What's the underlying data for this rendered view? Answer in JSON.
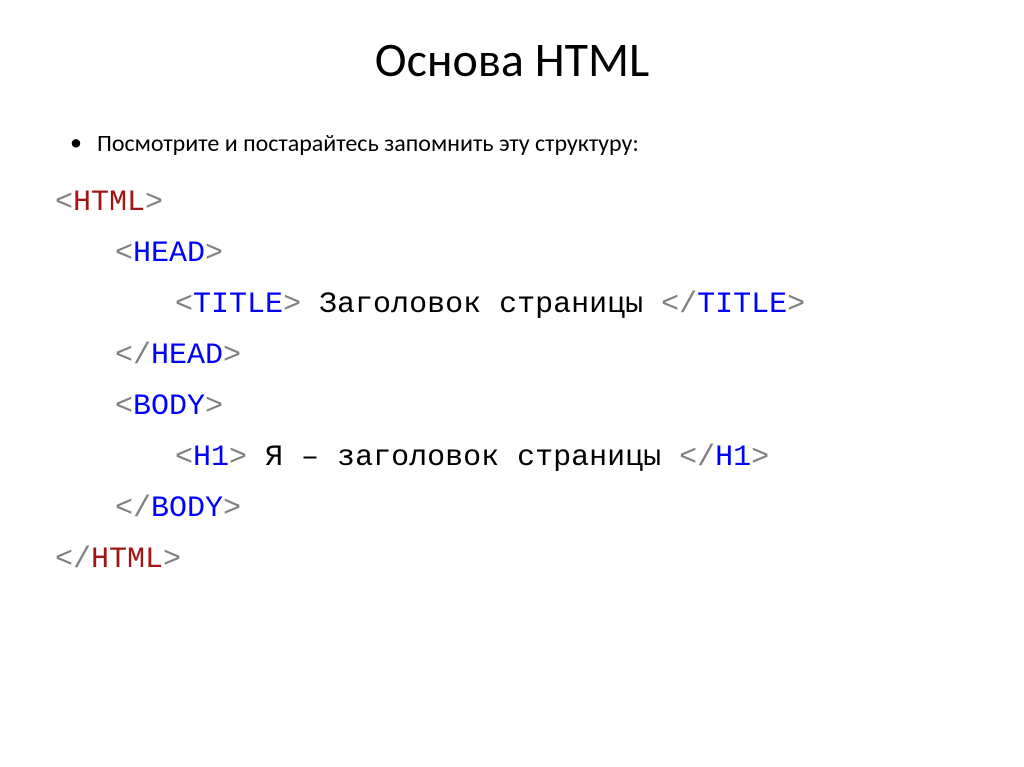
{
  "slide": {
    "title": "Основа HTML",
    "bullet_text": "Посмотрите и постарайтесь запомнить эту структуру:",
    "code": {
      "line1": {
        "open_br": "<",
        "tag": "HTML",
        "close_br": ">"
      },
      "line2": {
        "open_br": "<",
        "tag": "HEAD",
        "close_br": ">"
      },
      "line3": {
        "open_br1": "<",
        "tag1": "TITLE",
        "close_br1": ">",
        "text": " Заголовок страницы ",
        "open_br2": "</",
        "tag2": "TITLE",
        "close_br2": ">"
      },
      "line4": {
        "open_br": "</",
        "tag": "HEAD",
        "close_br": ">"
      },
      "line5": {
        "open_br": "<",
        "tag": "BODY",
        "close_br": ">"
      },
      "line6": {
        "open_br1": "<",
        "tag1": "H1",
        "close_br1": ">",
        "text": " Я – заголовок страницы ",
        "open_br2": "</",
        "tag2": "H1",
        "close_br2": ">"
      },
      "line7": {
        "open_br": "</",
        "tag": "BODY",
        "close_br": ">"
      },
      "line8": {
        "open_br": "</",
        "tag": "HTML",
        "close_br": ">"
      }
    }
  }
}
